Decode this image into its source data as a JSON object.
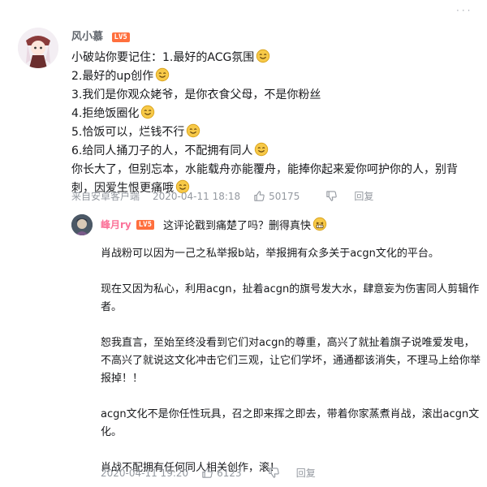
{
  "comment": {
    "username": "风小慕",
    "level_badge": "LV5",
    "lines": [
      "小破站你要记住：1.最好的ACG氛围",
      "2.最好的up创作",
      "3.我们是你观众姥爷，是你衣食父母，不是你粉丝",
      "4.拒绝饭圈化",
      "5.恰饭可以，烂钱不行",
      "6.给同人捅刀子的人，不配拥有同人",
      "你长大了，但别忘本，水能载舟亦能覆舟，能捧你起来爱你呵护你的人，别背刺，因爱生恨更痛哦"
    ],
    "source": "来自安卓客户端",
    "time": "2020-04-11 18:18",
    "likes": "50175",
    "reply_label": "回复",
    "emoji_icon": "smile-emoji-icon"
  },
  "reply": {
    "username": "峰月ry",
    "level_badge": "LV5",
    "prefix": "这评论戳到痛楚了吗？删得真快",
    "paragraphs": [
      "肖战粉可以因为一己之私举报b站，举报拥有众多关于acgn文化的平台。",
      "现在又因为私心，利用acgn，扯着acgn的旗号发大水，肆意妄为伤害同人剪辑作者。",
      "恕我直言，至始至终没看到它们对acgn的尊重，高兴了就扯着旗子说唯爱发电，不高兴了就说这文化冲击它们三观，让它们学坏，通通都该消失，不理马上给你举报掉！！",
      "acgn文化不是你任性玩具，召之即来挥之即去，带着你家蒸煮肖战，滚出acgn文化。",
      "肖战不配拥有任何同人相关创作，滚！"
    ],
    "time": "2020-04-11 19:20",
    "likes": "6123",
    "reply_label": "回复",
    "emoji_icon": "grin-emoji-icon"
  },
  "colors": {
    "accent_pink": "#fb7299",
    "level_orange": "#ff6f3d",
    "meta_gray": "#9499a0",
    "emoji_yellow": "#f7c948"
  }
}
